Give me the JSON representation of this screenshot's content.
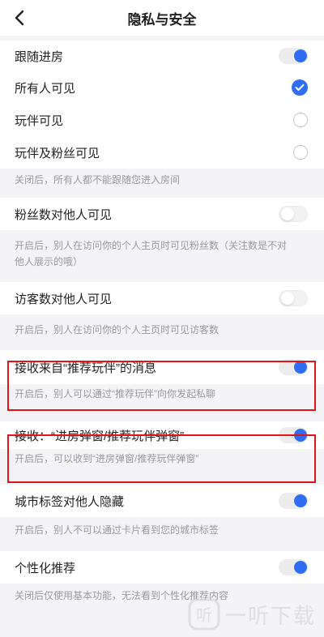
{
  "header": {
    "title": "隐私与安全"
  },
  "follow_room": {
    "label": "跟随进房",
    "toggle": "on",
    "options": [
      {
        "label": "所有人可见",
        "checked": true
      },
      {
        "label": "玩伴可见",
        "checked": false
      },
      {
        "label": "玩伴及粉丝可见",
        "checked": false
      }
    ],
    "note": "关闭后，所有人都不能跟随您进入房间"
  },
  "fans_count": {
    "label": "粉丝数对他人可见",
    "toggle": "off",
    "note_line1": "开启后，别人在访问你的个人主页时可见粉丝数（关注数是不对",
    "note_line2": "他人展示的哦）"
  },
  "visitor_count": {
    "label": "访客数对他人可见",
    "toggle": "off",
    "note": "开启后，别人在访问你的个人主页时可见访客数"
  },
  "recommend_msg": {
    "label": "接收来自“推荐玩伴”的消息",
    "toggle": "on",
    "note": "开启后，别人可以通过“推荐玩伴”向你发起私聊"
  },
  "popup": {
    "label": "接收：“进房弹窗/推荐玩伴弹窗”",
    "toggle": "on",
    "note": "开启后，可以收到“进房弹窗/推荐玩伴弹窗”"
  },
  "city_tag": {
    "label": "城市标签对他人隐藏",
    "toggle": "on",
    "note": "开启后，别人不可以通过卡片看到您的城市标签"
  },
  "personalized": {
    "label": "个性化推荐",
    "toggle": "on",
    "note": "关闭后仅使用基本功能，无法看到个性化推荐内容"
  },
  "watermark": {
    "text": "一听下载"
  },
  "colors": {
    "accent": "#2f6ef4",
    "highlight": "#e3131b"
  }
}
